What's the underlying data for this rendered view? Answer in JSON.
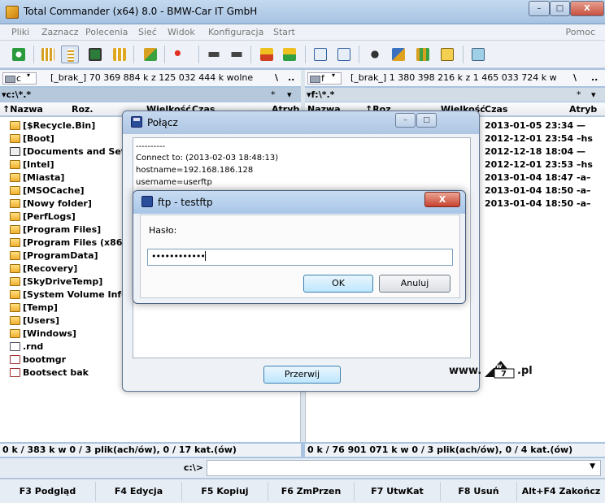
{
  "window": {
    "title": "Total Commander (x64) 8.0 - BMW-Car IT GmbH"
  },
  "menu": {
    "items": [
      "Pliki",
      "Zaznacz",
      "Polecenia",
      "Sieć",
      "Widok",
      "Konfiguracja",
      "Start"
    ],
    "help": "Pomoc"
  },
  "left_drive": {
    "letter": "c",
    "info": "[_brak_]  70 369 884 k z 125 032 444 k wolne",
    "btn_root": "\\",
    "btn_up": "..",
    "path": "▾c:\\*.*",
    "star": "*",
    "arrow": "▾"
  },
  "right_drive": {
    "letter": "f",
    "info": "[_brak_]  1 380 398 216 k z 1 465 033 724 k w",
    "btn_root": "\\",
    "btn_up": "..",
    "path": "▾f:\\*.*",
    "star": "*",
    "arrow": "▾"
  },
  "left_columns": {
    "name": "↑Nazwa",
    "ext": "Roz.",
    "size": "Wielkość",
    "date": "Czas",
    "attr": "Atryb"
  },
  "right_columns": {
    "name": "Nazwa",
    "ext": "↑Roz.",
    "size": "Wielkość",
    "date": "Czas",
    "attr": "Atryb"
  },
  "left_files": [
    {
      "name": "[$Recycle.Bin]",
      "type": "folder"
    },
    {
      "name": "[Boot]",
      "type": "folder"
    },
    {
      "name": "[Documents and Setti",
      "type": "link"
    },
    {
      "name": "[Intel]",
      "type": "folder"
    },
    {
      "name": "[Miasta]",
      "type": "folder"
    },
    {
      "name": "[MSOCache]",
      "type": "folder"
    },
    {
      "name": "[Nowy folder]",
      "type": "folder"
    },
    {
      "name": "[PerfLogs]",
      "type": "folder"
    },
    {
      "name": "[Program Files]",
      "type": "folder"
    },
    {
      "name": "[Program Files (x86)]",
      "type": "folder"
    },
    {
      "name": "[ProgramData]",
      "type": "folder"
    },
    {
      "name": "[Recovery]",
      "type": "folder"
    },
    {
      "name": "[SkyDriveTemp]",
      "type": "folder"
    },
    {
      "name": "[System Volume Inform",
      "type": "folder"
    },
    {
      "name": "[Temp]",
      "type": "folder"
    },
    {
      "name": "[Users]",
      "type": "folder"
    },
    {
      "name": "[Windows]",
      "type": "folder"
    },
    {
      "name": ".rnd",
      "type": "file"
    },
    {
      "name": "bootmgr",
      "type": "exec"
    },
    {
      "name": "Bootsect bak",
      "type": "exec"
    }
  ],
  "right_dates": [
    "2013-01-05 23:34 —",
    "2012-12-01 23:54 –hs",
    "2012-12-18 18:04 —",
    "2012-12-01 23:53 –hs",
    "2013-01-04 18:47 -a–",
    "2013-01-04 18:50 -a–",
    "2013-01-04 18:50 -a–"
  ],
  "status": {
    "left": "0 k / 383 k w 0 / 3 plik(ach/ów), 0 / 17 kat.(ów)",
    "right": "0 k / 76 901 071 k w 0 / 3 plik(ach/ów), 0 / 4 kat.(ów)"
  },
  "command": {
    "prompt": "c:\\>",
    "value": ""
  },
  "fkeys": [
    "F3 Podgląd",
    "F4 Edycja",
    "F5 Kopiuj",
    "F6 ZmPrzen",
    "F7 UtwKat",
    "F8 Usuń",
    "Alt+F4 Zakończ"
  ],
  "connect_dialog": {
    "title": "Połącz",
    "log": [
      "----------",
      "Connect to: (2013-02-03 18:48:13)",
      "hostname=192.168.186.128",
      "username=userftp"
    ],
    "abort_button": "Przerwij"
  },
  "password_dialog": {
    "title": "ftp - testftp",
    "label": "Hasło:",
    "masked_value": "••••••••••••",
    "ok_button": "OK",
    "cancel_button": "Anuluj",
    "close_glyph": "X"
  },
  "watermark": {
    "prefix": "www.",
    "logo_text": "slow",
    "digit": "7",
    "suffix": ".pl"
  },
  "window_controls": {
    "minimize": "–",
    "maximize": "□",
    "close": "X"
  }
}
